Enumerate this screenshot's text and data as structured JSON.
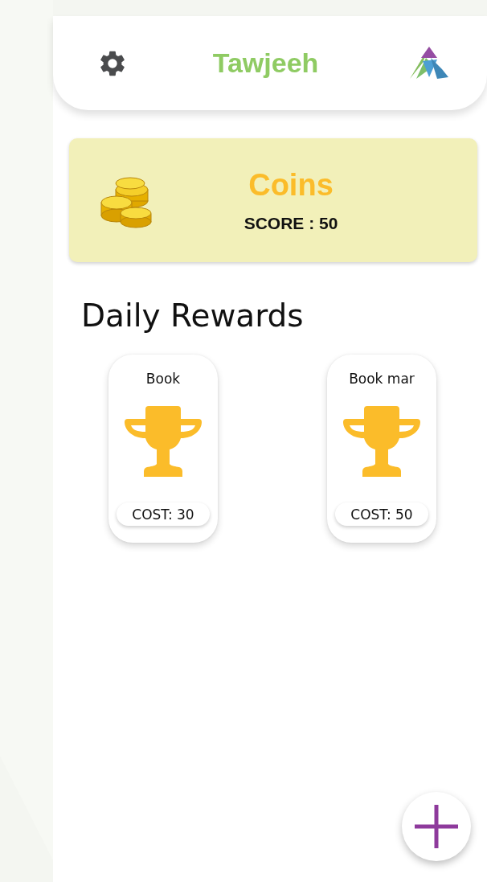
{
  "header": {
    "title": "Tawjeeh"
  },
  "coins": {
    "title": "Coins",
    "score": "SCORE : 50"
  },
  "section_title": "Daily Rewards",
  "rewards": [
    {
      "name": "Book",
      "cost": "COST: 30"
    },
    {
      "name": "Book mar",
      "cost": "COST: 50"
    }
  ]
}
